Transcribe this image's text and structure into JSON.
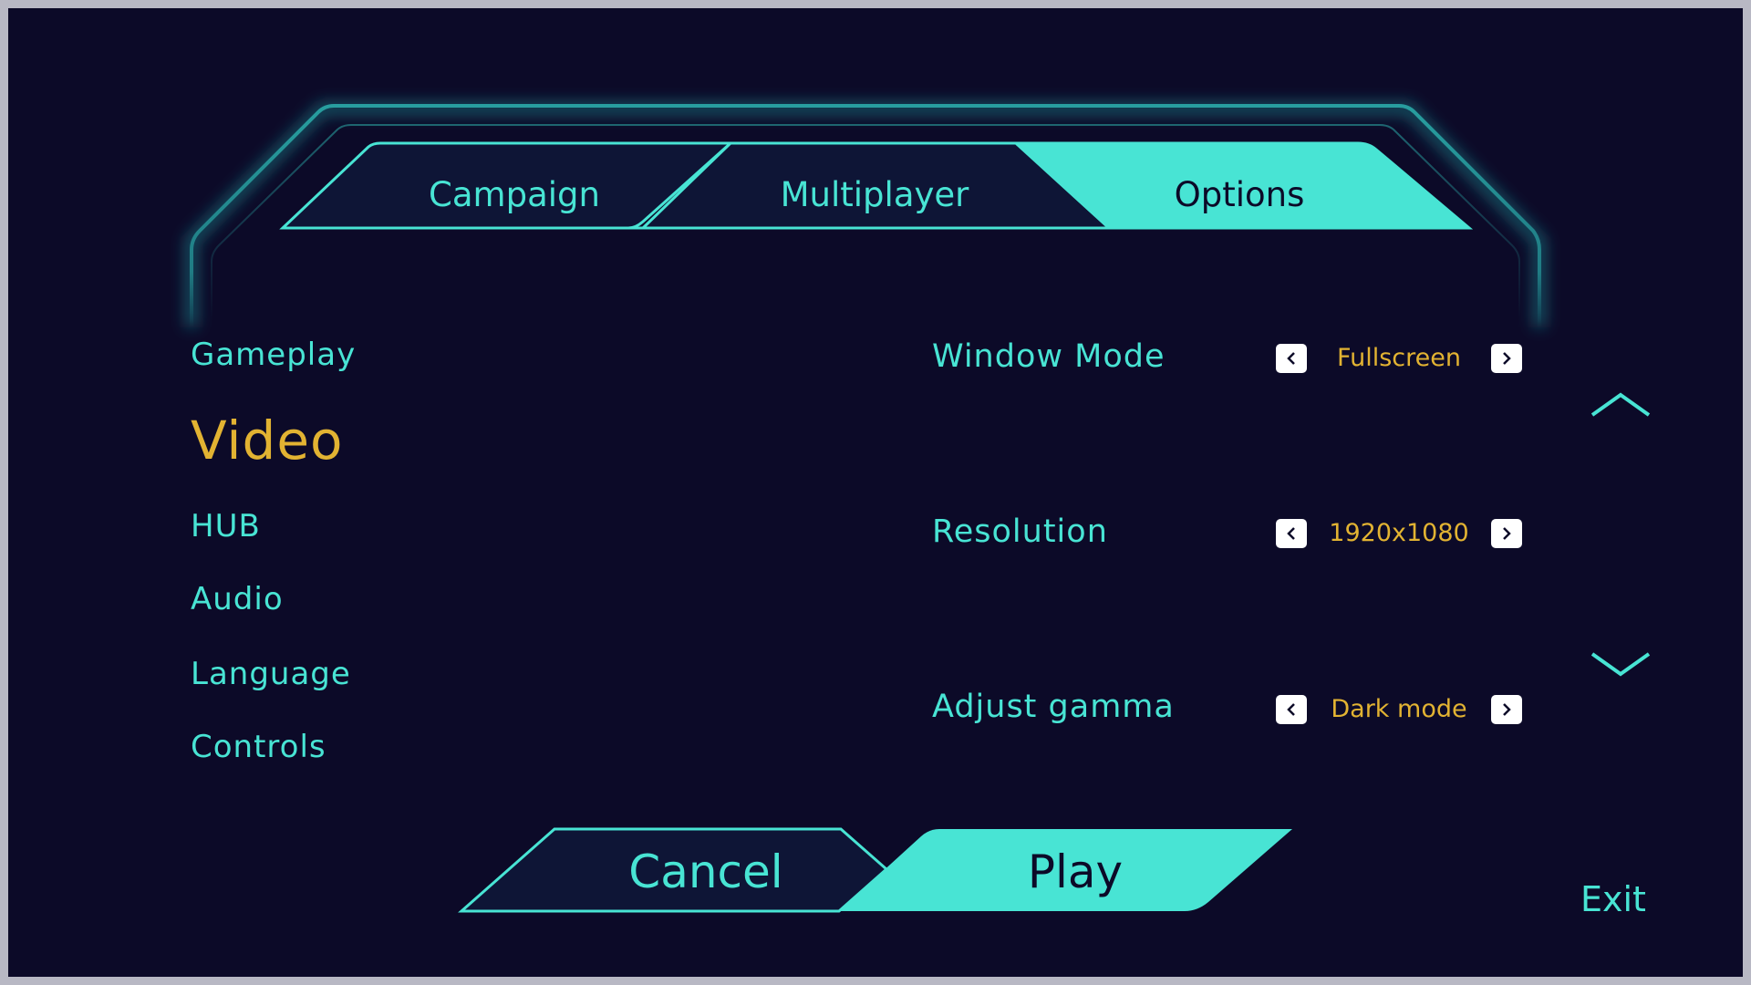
{
  "colors": {
    "background": "#0c0a28",
    "accent": "#48e4d4",
    "highlight": "#e2b332"
  },
  "tabs": [
    {
      "label": "Campaign",
      "active": false
    },
    {
      "label": "Multiplayer",
      "active": false
    },
    {
      "label": "Options",
      "active": true
    }
  ],
  "sidebar": {
    "items": [
      {
        "label": "Gameplay",
        "selected": false
      },
      {
        "label": "Video",
        "selected": true
      },
      {
        "label": "HUB",
        "selected": false
      },
      {
        "label": "Audio",
        "selected": false
      },
      {
        "label": "Language",
        "selected": false
      },
      {
        "label": "Controls",
        "selected": false
      }
    ]
  },
  "settings": [
    {
      "label": "Window Mode",
      "value": "Fullscreen",
      "prev_icon": "chevron-left-icon",
      "next_icon": "chevron-right-icon"
    },
    {
      "label": "Resolution",
      "value": "1920x1080",
      "prev_icon": "chevron-left-icon",
      "next_icon": "chevron-right-icon"
    },
    {
      "label": "Adjust gamma",
      "value": "Dark mode",
      "prev_icon": "chevron-left-icon",
      "next_icon": "chevron-right-icon"
    }
  ],
  "scroll": {
    "up_icon": "chevron-up-icon",
    "down_icon": "chevron-down-icon"
  },
  "actions": {
    "cancel_label": "Cancel",
    "play_label": "Play"
  },
  "exit_label": "Exit"
}
